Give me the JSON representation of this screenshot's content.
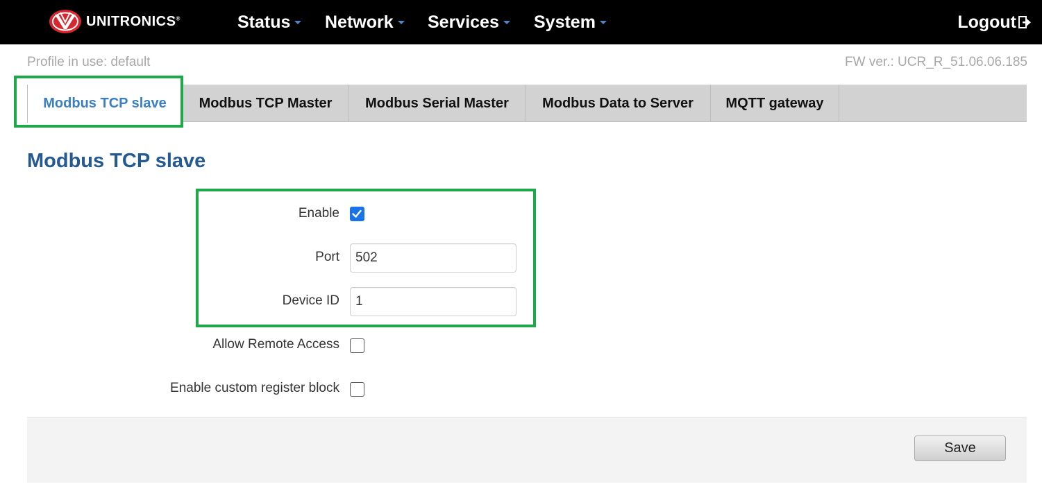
{
  "header": {
    "brand": "UNITRONICS",
    "brand_mark": "®",
    "brand_color": "#d7262e",
    "nav": [
      {
        "label": "Status"
      },
      {
        "label": "Network"
      },
      {
        "label": "Services"
      },
      {
        "label": "System"
      }
    ],
    "logout_label": "Logout",
    "logout_icon": "logout-icon"
  },
  "subheader": {
    "profile": "Profile in use: default",
    "firmware": "FW ver.: UCR_R_51.06.06.185"
  },
  "tabs": [
    {
      "label": "Modbus TCP slave",
      "active": true
    },
    {
      "label": "Modbus TCP Master",
      "active": false
    },
    {
      "label": "Modbus Serial Master",
      "active": false
    },
    {
      "label": "Modbus Data to Server",
      "active": false
    },
    {
      "label": "MQTT gateway",
      "active": false
    }
  ],
  "section": {
    "title": "Modbus TCP slave"
  },
  "form": {
    "enable": {
      "label": "Enable",
      "checked": true
    },
    "port": {
      "label": "Port",
      "value": "502"
    },
    "device_id": {
      "label": "Device ID",
      "value": "1"
    },
    "allow_remote": {
      "label": "Allow Remote Access",
      "checked": false
    },
    "custom_block": {
      "label": "Enable custom register block",
      "checked": false
    }
  },
  "footer": {
    "save_label": "Save"
  },
  "colors": {
    "accent": "#3a7ec4",
    "title": "#245a91",
    "highlight": "#1fa84a",
    "checkbox_checked": "#1a73e8"
  }
}
